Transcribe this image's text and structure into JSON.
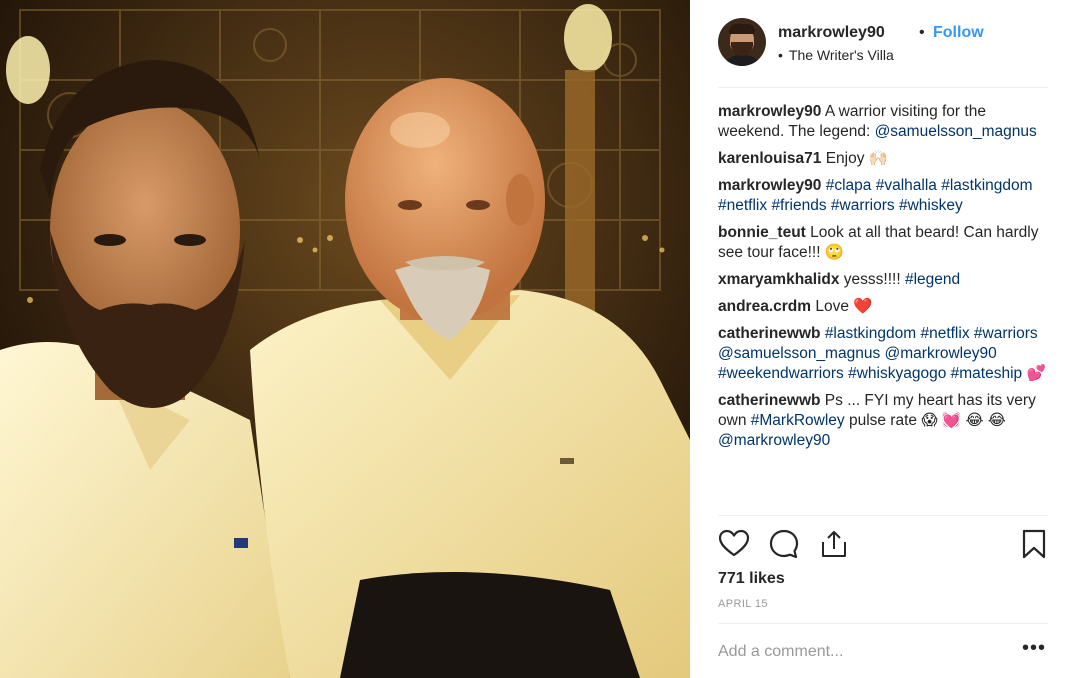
{
  "post": {
    "author": "markrowley90",
    "follow_label": "Follow",
    "separator": "•",
    "location": "The Writer's Villa",
    "location_bullet": "•"
  },
  "comments": [
    {
      "user": "markrowley90",
      "parts": [
        {
          "t": "text",
          "v": " A warrior visiting for the weekend. The legend: "
        },
        {
          "t": "tag",
          "v": "@samuelsson_magnus"
        }
      ]
    },
    {
      "user": "karenlouisa71",
      "parts": [
        {
          "t": "text",
          "v": " Enjoy 🙌🏻"
        }
      ]
    },
    {
      "user": "markrowley90",
      "parts": [
        {
          "t": "text",
          "v": " "
        },
        {
          "t": "tag",
          "v": "#clapa"
        },
        {
          "t": "text",
          "v": " "
        },
        {
          "t": "tag",
          "v": "#valhalla"
        },
        {
          "t": "text",
          "v": " "
        },
        {
          "t": "tag",
          "v": "#lastkingdom"
        },
        {
          "t": "text",
          "v": " "
        },
        {
          "t": "tag",
          "v": "#netflix"
        },
        {
          "t": "text",
          "v": " "
        },
        {
          "t": "tag",
          "v": "#friends"
        },
        {
          "t": "text",
          "v": " "
        },
        {
          "t": "tag",
          "v": "#warriors"
        },
        {
          "t": "text",
          "v": " "
        },
        {
          "t": "tag",
          "v": "#whiskey"
        }
      ]
    },
    {
      "user": "bonnie_teut",
      "parts": [
        {
          "t": "text",
          "v": " Look at all that beard! Can hardly see tour face!!! 🙄"
        }
      ]
    },
    {
      "user": "xmaryamkhalidx",
      "parts": [
        {
          "t": "text",
          "v": " yesss!!!! "
        },
        {
          "t": "tag",
          "v": "#legend"
        }
      ]
    },
    {
      "user": "andrea.crdm",
      "parts": [
        {
          "t": "text",
          "v": " Love ❤️"
        }
      ]
    },
    {
      "user": "catherinewwb",
      "parts": [
        {
          "t": "text",
          "v": " "
        },
        {
          "t": "tag",
          "v": "#lastkingdom"
        },
        {
          "t": "text",
          "v": " "
        },
        {
          "t": "tag",
          "v": "#netflix"
        },
        {
          "t": "text",
          "v": " "
        },
        {
          "t": "tag",
          "v": "#warriors"
        },
        {
          "t": "text",
          "v": " "
        },
        {
          "t": "tag",
          "v": "@samuelsson_magnus"
        },
        {
          "t": "text",
          "v": " "
        },
        {
          "t": "tag",
          "v": "@markrowley90"
        },
        {
          "t": "text",
          "v": " "
        },
        {
          "t": "tag",
          "v": "#weekendwarriors"
        },
        {
          "t": "text",
          "v": " "
        },
        {
          "t": "tag",
          "v": "#whiskyagogo"
        },
        {
          "t": "text",
          "v": " "
        },
        {
          "t": "tag",
          "v": "#mateship"
        },
        {
          "t": "text",
          "v": " 💕"
        }
      ]
    },
    {
      "user": "catherinewwb",
      "parts": [
        {
          "t": "text",
          "v": " Ps ... FYI my heart has its very own "
        },
        {
          "t": "tag",
          "v": "#MarkRowley"
        },
        {
          "t": "text",
          "v": " pulse rate 😱 💓 😂 😂 "
        },
        {
          "t": "tag",
          "v": "@markrowley90"
        }
      ]
    }
  ],
  "actions": {
    "like_icon": "heart-outline-icon",
    "comment_icon": "speech-bubble-icon",
    "share_icon": "share-icon",
    "save_icon": "bookmark-icon"
  },
  "likes_text": "771 likes",
  "date_text": "APRIL 15",
  "comment_box": {
    "placeholder": "Add a comment..."
  },
  "more_label": "•••",
  "colors": {
    "link": "#003569",
    "follow": "#3897f0",
    "muted": "#999999",
    "divider": "#efefef"
  }
}
